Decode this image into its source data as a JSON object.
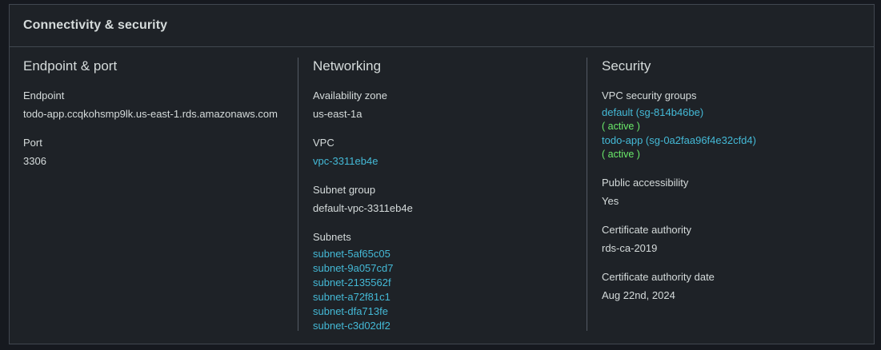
{
  "panel": {
    "title": "Connectivity & security"
  },
  "endpoint_port": {
    "title": "Endpoint & port",
    "endpoint_label": "Endpoint",
    "endpoint_value": "todo-app.ccqkohsmp9lk.us-east-1.rds.amazonaws.com",
    "port_label": "Port",
    "port_value": "3306"
  },
  "networking": {
    "title": "Networking",
    "az_label": "Availability zone",
    "az_value": "us-east-1a",
    "vpc_label": "VPC",
    "vpc_value": "vpc-3311eb4e",
    "subnet_group_label": "Subnet group",
    "subnet_group_value": "default-vpc-3311eb4e",
    "subnets_label": "Subnets",
    "subnets": [
      "subnet-5af65c05",
      "subnet-9a057cd7",
      "subnet-2135562f",
      "subnet-a72f81c1",
      "subnet-dfa713fe",
      "subnet-c3d02df2"
    ]
  },
  "security": {
    "title": "Security",
    "sg_label": "VPC security groups",
    "security_groups": [
      {
        "name": "default (sg-814b46be)",
        "status": "( active )"
      },
      {
        "name": "todo-app (sg-0a2faa96f4e32cfd4)",
        "status": "( active )"
      }
    ],
    "public_label": "Public accessibility",
    "public_value": "Yes",
    "ca_label": "Certificate authority",
    "ca_value": "rds-ca-2019",
    "ca_date_label": "Certificate authority date",
    "ca_date_value": "Aug 22nd, 2024"
  },
  "colors": {
    "background": "#16191f",
    "panel": "#1e2227",
    "text": "#d5dbdb",
    "link": "#44b9d6",
    "active": "#6aeb6a",
    "border": "#414750"
  }
}
